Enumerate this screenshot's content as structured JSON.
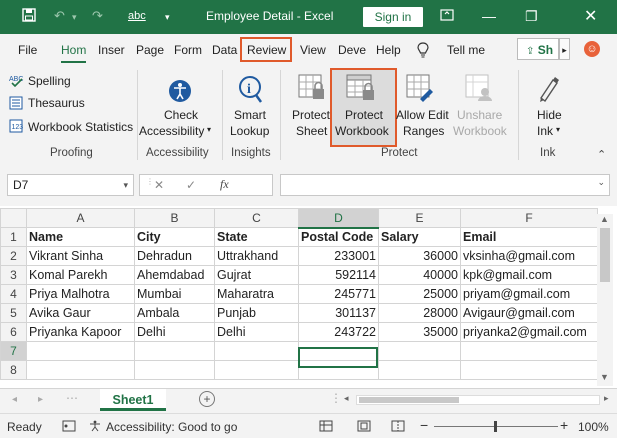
{
  "titlebar": {
    "title": "Employee Detail  -  Excel",
    "sign_in": "Sign in",
    "autosave_glyph": "abc"
  },
  "tabs": [
    "File",
    "Hom",
    "Inser",
    "Page",
    "Form",
    "Data",
    "Review",
    "View",
    "Deve",
    "Help"
  ],
  "tell_me": "Tell me",
  "share": "Sh",
  "ribbon": {
    "proofing": {
      "spelling": "Spelling",
      "thesaurus": "Thesaurus",
      "workbook_statistics": "Workbook Statistics",
      "label": "Proofing"
    },
    "accessibility": {
      "check_line1": "Check",
      "check_line2": "Accessibility",
      "label": "Accessibility"
    },
    "insights": {
      "smart_line1": "Smart",
      "smart_line2": "Lookup",
      "label": "Insights"
    },
    "protect": {
      "sheet_line1": "Protect",
      "sheet_line2": "Sheet",
      "workbook_line1": "Protect",
      "workbook_line2": "Workbook",
      "allow_line1": "Allow Edit",
      "allow_line2": "Ranges",
      "unshare_line1": "Unshare",
      "unshare_line2": "Workbook",
      "label": "Protect"
    },
    "ink": {
      "hide_line1": "Hide",
      "hide_line2": "Ink",
      "label": "Ink"
    }
  },
  "formula_bar": {
    "name_box": "D7",
    "fx": "fx",
    "formula": ""
  },
  "grid": {
    "columns": [
      "A",
      "B",
      "C",
      "D",
      "E",
      "F"
    ],
    "rows": [
      [
        "Name",
        "City",
        "State",
        "Postal Code",
        "Salary",
        "Email"
      ],
      [
        "Vikrant Sinha",
        "Dehradun",
        "Uttrakhand",
        "233001",
        "36000",
        "vksinha@gmail.com"
      ],
      [
        "Komal Parekh",
        "Ahemdabad",
        "Gujrat",
        "592114",
        "40000",
        "kpk@gmail.com"
      ],
      [
        "Priya Malhotra",
        "Mumbai",
        "Maharatra",
        "245771",
        "25000",
        "priyam@gmail.com"
      ],
      [
        "Avika Gaur",
        "Ambala",
        "Punjab",
        "301137",
        "28000",
        "Avigaur@gmail.com"
      ],
      [
        "Priyanka Kapoor",
        "Delhi",
        "Delhi",
        "243722",
        "35000",
        "priyanka2@gmail.com"
      ],
      [
        "",
        "",
        "",
        "",
        "",
        ""
      ],
      [
        "",
        "",
        "",
        "",
        "",
        ""
      ]
    ],
    "row_numbers": [
      "1",
      "2",
      "3",
      "4",
      "5",
      "6",
      "7",
      "8"
    ],
    "selected_cell": "D7"
  },
  "sheet_tabs": {
    "active": "Sheet1",
    "add": "+"
  },
  "status": {
    "ready": "Ready",
    "accessibility": "Accessibility: Good to go",
    "zoom": "100%"
  },
  "colors": {
    "brand": "#217346",
    "highlight": "#e05a2b"
  }
}
